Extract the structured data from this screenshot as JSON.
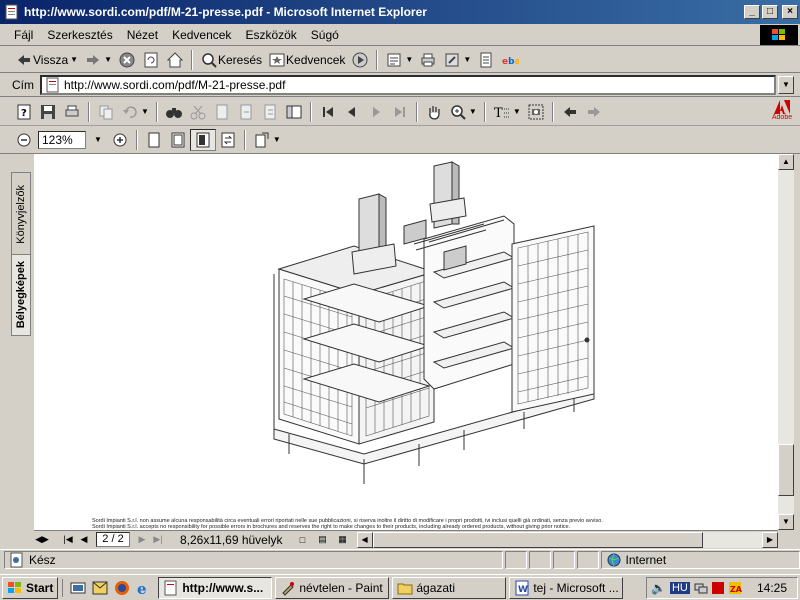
{
  "window": {
    "title": "http://www.sordi.com/pdf/M-21-presse.pdf - Microsoft Internet Explorer",
    "minimize": "_",
    "maximize": "□",
    "close": "×"
  },
  "menu": [
    "Fájl",
    "Szerkesztés",
    "Nézet",
    "Kedvencek",
    "Eszközök",
    "Súgó"
  ],
  "toolbar": {
    "back_label": "Vissza",
    "search_label": "Keresés",
    "favorites_label": "Kedvencek"
  },
  "address": {
    "label": "Cím",
    "url": "http://www.sordi.com/pdf/M-21-presse.pdf"
  },
  "pdf": {
    "zoom": "123%",
    "page_field": "2 / 2",
    "page_size": "8,26x11,69 hüvelyk",
    "sidebar_tabs": {
      "bookmarks": "Könyvjelzők",
      "thumbnails": "Bélyegképek"
    },
    "footer_line1": "Sordi Impianti S.r.l. non assume alcuna responsabilità circa eventuali errori riportati nelle sue pubblicazioni, si riserva inoltre il diritto di modificare i propri prodotti,  ivi inclusi quelli già ordinati, senza previo avviso.",
    "footer_line2": "Sordi Impianti S.r.l. accepts no responsibility for possible errors in brochures and reserves the right to make changes to their products, including already ordered products, without giving prior notice."
  },
  "status": {
    "text": "Kész",
    "zone": "Internet"
  },
  "taskbar": {
    "start": "Start",
    "tasks": [
      "http://www.s...",
      "névtelen - Paint",
      "ágazati",
      "tej - Microsoft ..."
    ],
    "lang": "HU",
    "clock": "14:25"
  },
  "colors": {
    "titlebar": "#0a246a",
    "chrome": "#d4d0c8"
  }
}
